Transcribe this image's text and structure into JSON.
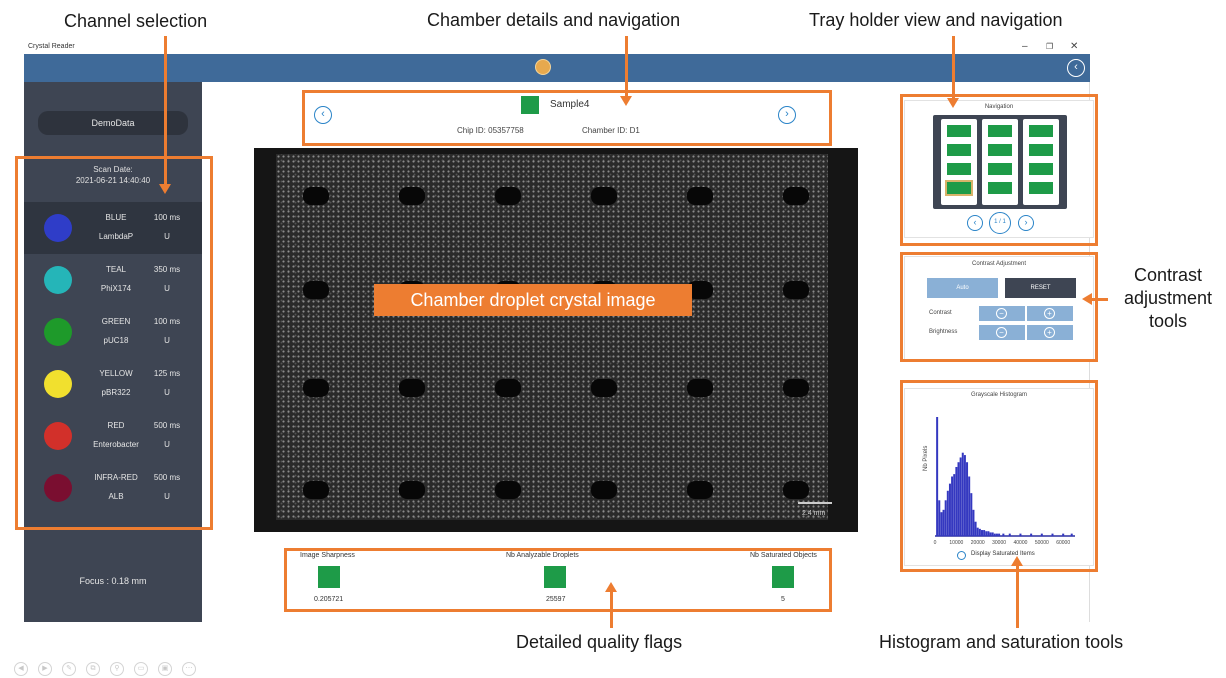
{
  "annotations": {
    "channel_selection": "Channel selection",
    "chamber_details": "Chamber details and navigation",
    "tray_holder": "Tray holder view and navigation",
    "contrast_tools_1": "Contrast",
    "contrast_tools_2": "adjustment",
    "contrast_tools_3": "tools",
    "quality_flags": "Detailed quality flags",
    "histogram_tools": "Histogram and saturation tools",
    "image_label": "Chamber droplet crystal image"
  },
  "window": {
    "title": "Crystal Reader",
    "minimize": "–",
    "maximize": "❐",
    "close": "✕"
  },
  "sidebar": {
    "dataset_button": "DemoData",
    "scan_date_label": "Scan Date:",
    "scan_date_value": "2021-06-21 14:40:40",
    "channels": [
      {
        "name": "BLUE",
        "exposure": "100 ms",
        "sample": "LambdaP",
        "unit": "U",
        "color": "#2F3DC8"
      },
      {
        "name": "TEAL",
        "exposure": "350 ms",
        "sample": "PhiX174",
        "unit": "U",
        "color": "#25B5B8"
      },
      {
        "name": "GREEN",
        "exposure": "100 ms",
        "sample": "pUC18",
        "unit": "U",
        "color": "#1E9A2A"
      },
      {
        "name": "YELLOW",
        "exposure": "125 ms",
        "sample": "pBR322",
        "unit": "U",
        "color": "#F1E02E"
      },
      {
        "name": "RED",
        "exposure": "500 ms",
        "sample": "Enterobacter",
        "unit": "U",
        "color": "#D2302A"
      },
      {
        "name": "INFRA-RED",
        "exposure": "500 ms",
        "sample": "ALB",
        "unit": "U",
        "color": "#7A0E30"
      }
    ],
    "focus": "Focus : 0.18 mm"
  },
  "chamber": {
    "sample_name": "Sample4",
    "chip_id": "Chip ID: 05357758",
    "chamber_id": "Chamber ID: D1",
    "prev": "‹",
    "next": "›",
    "scale_label": "2.4 mm"
  },
  "quality": {
    "sharpness_label": "Image Sharpness",
    "sharpness_value": "0.205721",
    "droplets_label": "Nb Analyzable Droplets",
    "droplets_value": "25597",
    "saturated_label": "Nb Saturated Objects",
    "saturated_value": "5",
    "flag_color": "#1E9B48"
  },
  "navigation_panel": {
    "title": "Navigation",
    "page_indicator": "1 / 1",
    "prev": "‹",
    "next": "›"
  },
  "contrast_panel": {
    "title": "Contrast Adjustment",
    "auto_label": "Auto",
    "reset_label": "RESET",
    "contrast_label": "Contrast",
    "brightness_label": "Brightness",
    "minus": "−",
    "plus": "+"
  },
  "histogram_panel": {
    "title": "Grayscale Histogram",
    "ylabel": "Nb Pixels",
    "xticks": [
      "0",
      "10000",
      "20000",
      "30000",
      "40000",
      "50000",
      "60000"
    ],
    "saturated_toggle_label": "Display Saturated Items"
  },
  "chart_data": {
    "type": "bar",
    "title": "Grayscale Histogram",
    "xlabel": "",
    "ylabel": "Nb Pixels",
    "xlim": [
      0,
      65535
    ],
    "x": [
      1000,
      2000,
      3000,
      4000,
      5000,
      6000,
      7000,
      8000,
      9000,
      10000,
      11000,
      12000,
      13000,
      14000,
      15000,
      16000,
      17000,
      18000,
      19000,
      20000,
      21000,
      22000,
      23000,
      24000,
      25000,
      26000,
      27000,
      28000,
      29000,
      30000,
      32000,
      35000,
      40000,
      45000,
      50000,
      55000,
      60000,
      64000
    ],
    "values": [
      100,
      30,
      20,
      22,
      30,
      38,
      44,
      50,
      52,
      58,
      62,
      66,
      70,
      68,
      62,
      50,
      36,
      22,
      12,
      7,
      6,
      5,
      5,
      4,
      4,
      3,
      3,
      2,
      2,
      2,
      2,
      2,
      2,
      2,
      2,
      2,
      2,
      2
    ]
  },
  "toolbar": {
    "icons": [
      "◀",
      "▶",
      "✎",
      "⧉",
      "⚲",
      "▭",
      "▣",
      "⋯"
    ]
  }
}
